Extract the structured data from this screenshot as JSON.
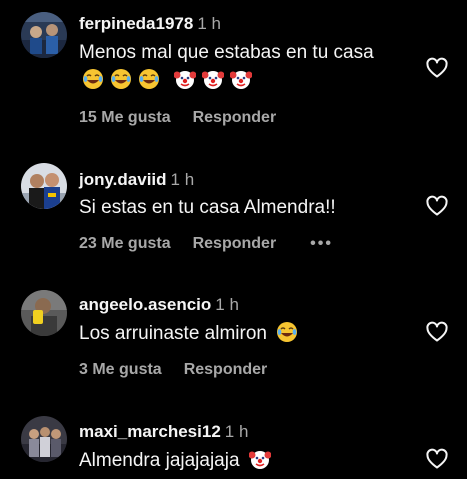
{
  "comments": [
    {
      "username": "ferpineda1978",
      "time": "1 h",
      "text": "Menos mal que estabas en tu casa",
      "emojis": [
        "joy-emoji",
        "joy-emoji",
        "joy-emoji",
        "clown-emoji",
        "clown-emoji",
        "clown-emoji"
      ],
      "likes": "15 Me gusta",
      "reply_label": "Responder",
      "avatar": "avatar-ferpineda1978"
    },
    {
      "username": "jony.daviid",
      "time": "1 h",
      "text": "Si estas en tu casa Almendra!!",
      "likes": "23 Me gusta",
      "reply_label": "Responder",
      "more_label": "•••",
      "avatar": "avatar-jony-daviid"
    },
    {
      "username": "angeelo.asencio",
      "time": "1 h",
      "text": "Los arruinaste almiron",
      "emojis": [
        "joy-emoji"
      ],
      "likes": "3 Me gusta",
      "reply_label": "Responder",
      "avatar": "avatar-angeelo-asencio"
    },
    {
      "username": "maxi_marchesi12",
      "time": "1 h",
      "text": "Almendra jajajajaja",
      "emojis": [
        "clown-emoji"
      ],
      "avatar": "avatar-maxi-marchesi12"
    }
  ],
  "icons": {
    "like": "heart-outline-icon",
    "more": "more-options-icon"
  },
  "colors": {
    "background": "#000000",
    "primary_text": "#f5f5f5",
    "secondary_text": "#a8a8a8"
  }
}
